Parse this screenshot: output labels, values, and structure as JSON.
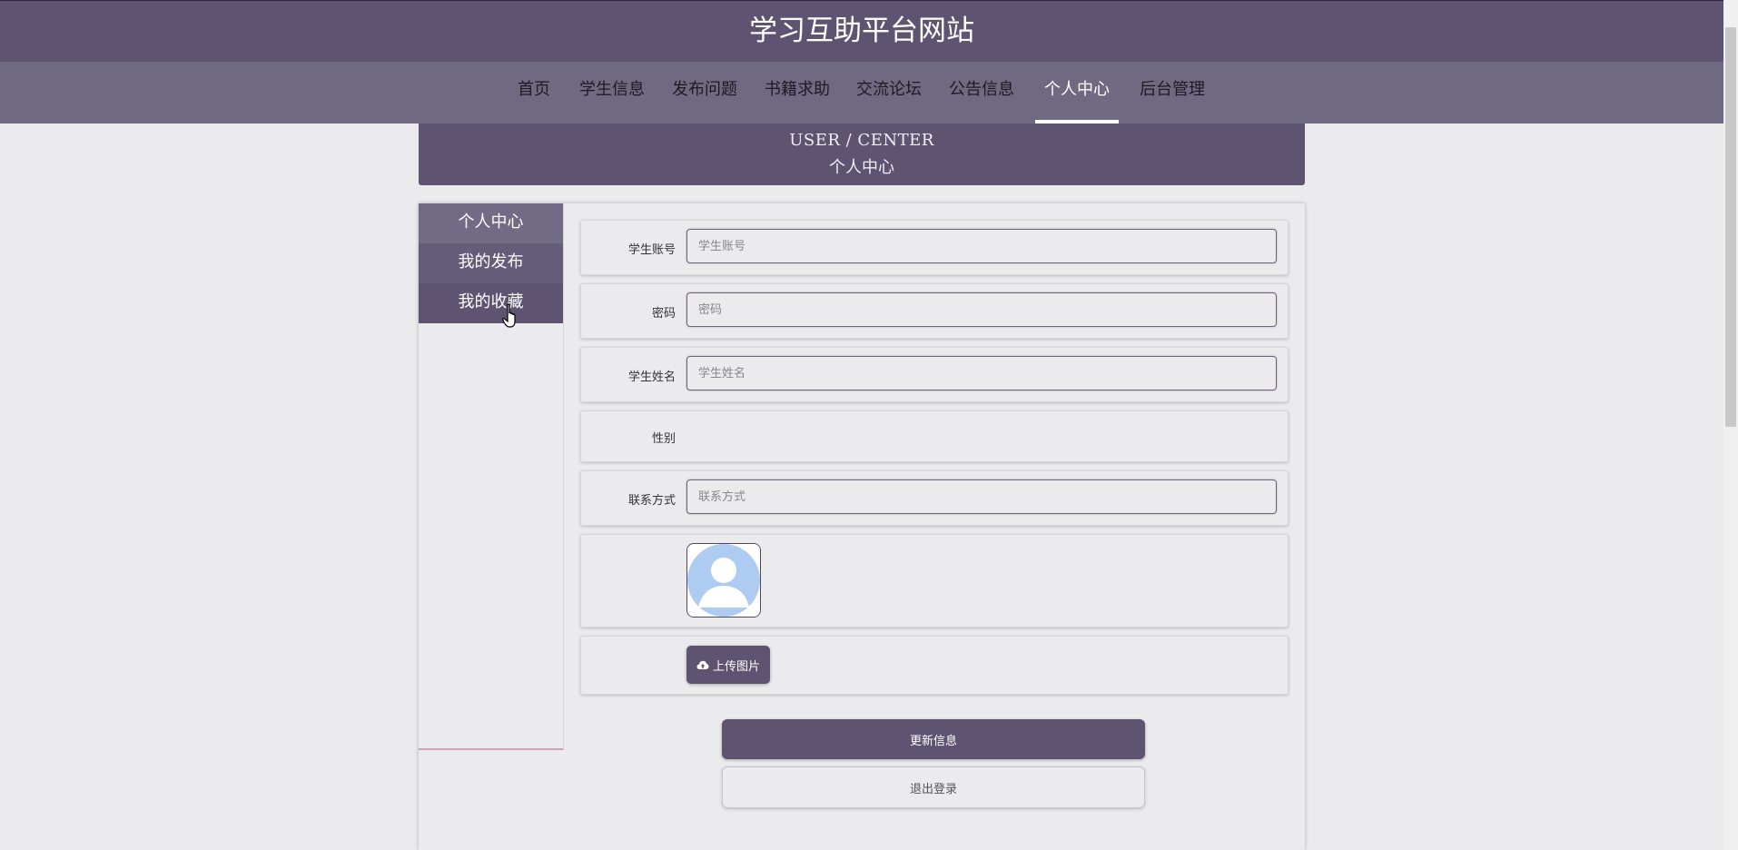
{
  "site": {
    "title": "学习互助平台网站"
  },
  "nav": {
    "items": [
      {
        "label": "首页"
      },
      {
        "label": "学生信息"
      },
      {
        "label": "发布问题"
      },
      {
        "label": "书籍求助"
      },
      {
        "label": "交流论坛"
      },
      {
        "label": "公告信息"
      },
      {
        "label": "个人中心",
        "active": true
      },
      {
        "label": "后台管理"
      }
    ]
  },
  "banner": {
    "en": "USER / CENTER",
    "cn": "个人中心"
  },
  "side_menu": {
    "items": [
      {
        "label": "个人中心"
      },
      {
        "label": "我的发布"
      },
      {
        "label": "我的收藏"
      }
    ]
  },
  "form": {
    "account": {
      "label": "学生账号",
      "placeholder": "学生账号",
      "value": ""
    },
    "password": {
      "label": "密码",
      "placeholder": "密码",
      "value": ""
    },
    "name": {
      "label": "学生姓名",
      "placeholder": "学生姓名",
      "value": ""
    },
    "gender": {
      "label": "性别"
    },
    "contact": {
      "label": "联系方式",
      "placeholder": "联系方式",
      "value": ""
    },
    "avatar": {
      "icon": "user-avatar-placeholder-icon"
    },
    "upload": {
      "label": "上传图片",
      "icon": "cloud-upload-icon"
    },
    "update_button": "更新信息",
    "logout_button": "退出登录"
  },
  "colors": {
    "primary": "#5e5471",
    "nav_bg": "#6f6982",
    "page_bg": "#ebeaec",
    "avatar_blue": "#aecbf2"
  }
}
